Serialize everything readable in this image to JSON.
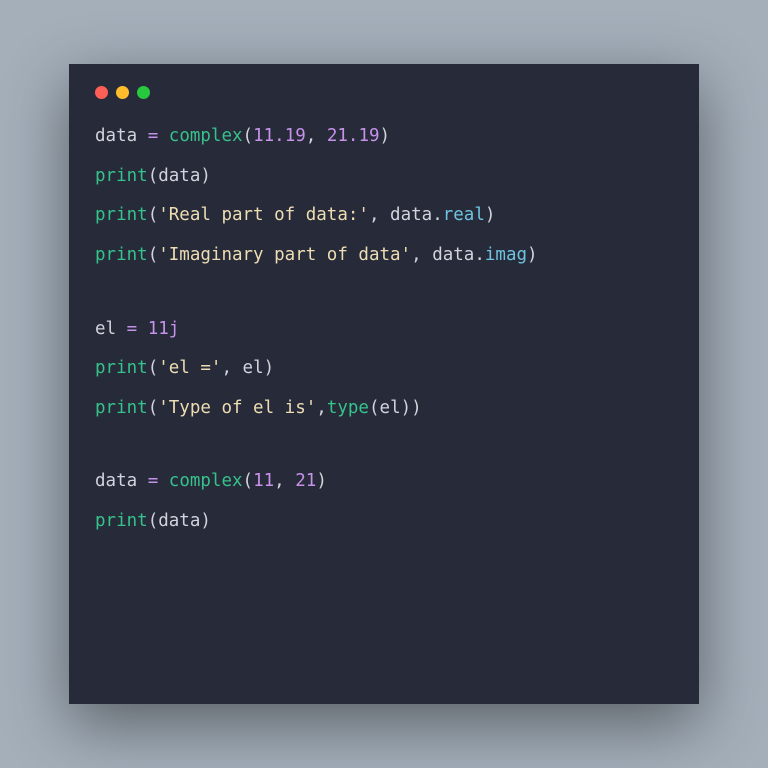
{
  "traffic_lights": [
    "close",
    "minimize",
    "zoom"
  ],
  "code": {
    "lines": [
      {
        "type": "code",
        "tokens": [
          {
            "t": "data ",
            "c": "tok-default"
          },
          {
            "t": "=",
            "c": "tok-op"
          },
          {
            "t": " ",
            "c": "tok-default"
          },
          {
            "t": "complex",
            "c": "tok-func"
          },
          {
            "t": "(",
            "c": "tok-punct"
          },
          {
            "t": "11.19",
            "c": "tok-num"
          },
          {
            "t": ", ",
            "c": "tok-punct"
          },
          {
            "t": "21.19",
            "c": "tok-num"
          },
          {
            "t": ")",
            "c": "tok-punct"
          }
        ]
      },
      {
        "type": "code",
        "tokens": [
          {
            "t": "print",
            "c": "tok-func"
          },
          {
            "t": "(",
            "c": "tok-punct"
          },
          {
            "t": "data",
            "c": "tok-default"
          },
          {
            "t": ")",
            "c": "tok-punct"
          }
        ]
      },
      {
        "type": "code",
        "tokens": [
          {
            "t": "print",
            "c": "tok-func"
          },
          {
            "t": "(",
            "c": "tok-punct"
          },
          {
            "t": "'Real part of data:'",
            "c": "tok-str"
          },
          {
            "t": ", ",
            "c": "tok-punct"
          },
          {
            "t": "data",
            "c": "tok-default"
          },
          {
            "t": ".",
            "c": "tok-punct"
          },
          {
            "t": "real",
            "c": "tok-attr"
          },
          {
            "t": ")",
            "c": "tok-punct"
          }
        ]
      },
      {
        "type": "code",
        "tokens": [
          {
            "t": "print",
            "c": "tok-func"
          },
          {
            "t": "(",
            "c": "tok-punct"
          },
          {
            "t": "'Imaginary part of data'",
            "c": "tok-str"
          },
          {
            "t": ", ",
            "c": "tok-punct"
          },
          {
            "t": "data",
            "c": "tok-default"
          },
          {
            "t": ".",
            "c": "tok-punct"
          },
          {
            "t": "imag",
            "c": "tok-attr"
          },
          {
            "t": ")",
            "c": "tok-punct"
          }
        ]
      },
      {
        "type": "blank"
      },
      {
        "type": "code",
        "tokens": [
          {
            "t": "el ",
            "c": "tok-default"
          },
          {
            "t": "=",
            "c": "tok-op"
          },
          {
            "t": " ",
            "c": "tok-default"
          },
          {
            "t": "11j",
            "c": "tok-j"
          }
        ]
      },
      {
        "type": "code",
        "tokens": [
          {
            "t": "print",
            "c": "tok-func"
          },
          {
            "t": "(",
            "c": "tok-punct"
          },
          {
            "t": "'el ='",
            "c": "tok-str"
          },
          {
            "t": ", ",
            "c": "tok-punct"
          },
          {
            "t": "el",
            "c": "tok-default"
          },
          {
            "t": ")",
            "c": "tok-punct"
          }
        ]
      },
      {
        "type": "code",
        "tokens": [
          {
            "t": "print",
            "c": "tok-func"
          },
          {
            "t": "(",
            "c": "tok-punct"
          },
          {
            "t": "'Type of el is'",
            "c": "tok-str"
          },
          {
            "t": ",",
            "c": "tok-punct"
          },
          {
            "t": "type",
            "c": "tok-func"
          },
          {
            "t": "(",
            "c": "tok-punct"
          },
          {
            "t": "el",
            "c": "tok-default"
          },
          {
            "t": "))",
            "c": "tok-punct"
          }
        ]
      },
      {
        "type": "blank"
      },
      {
        "type": "code",
        "tokens": [
          {
            "t": "data ",
            "c": "tok-default"
          },
          {
            "t": "=",
            "c": "tok-op"
          },
          {
            "t": " ",
            "c": "tok-default"
          },
          {
            "t": "complex",
            "c": "tok-func"
          },
          {
            "t": "(",
            "c": "tok-punct"
          },
          {
            "t": "11",
            "c": "tok-num"
          },
          {
            "t": ", ",
            "c": "tok-punct"
          },
          {
            "t": "21",
            "c": "tok-num"
          },
          {
            "t": ")",
            "c": "tok-punct"
          }
        ]
      },
      {
        "type": "code",
        "tokens": [
          {
            "t": "print",
            "c": "tok-func"
          },
          {
            "t": "(",
            "c": "tok-punct"
          },
          {
            "t": "data",
            "c": "tok-default"
          },
          {
            "t": ")",
            "c": "tok-punct"
          }
        ]
      }
    ]
  }
}
